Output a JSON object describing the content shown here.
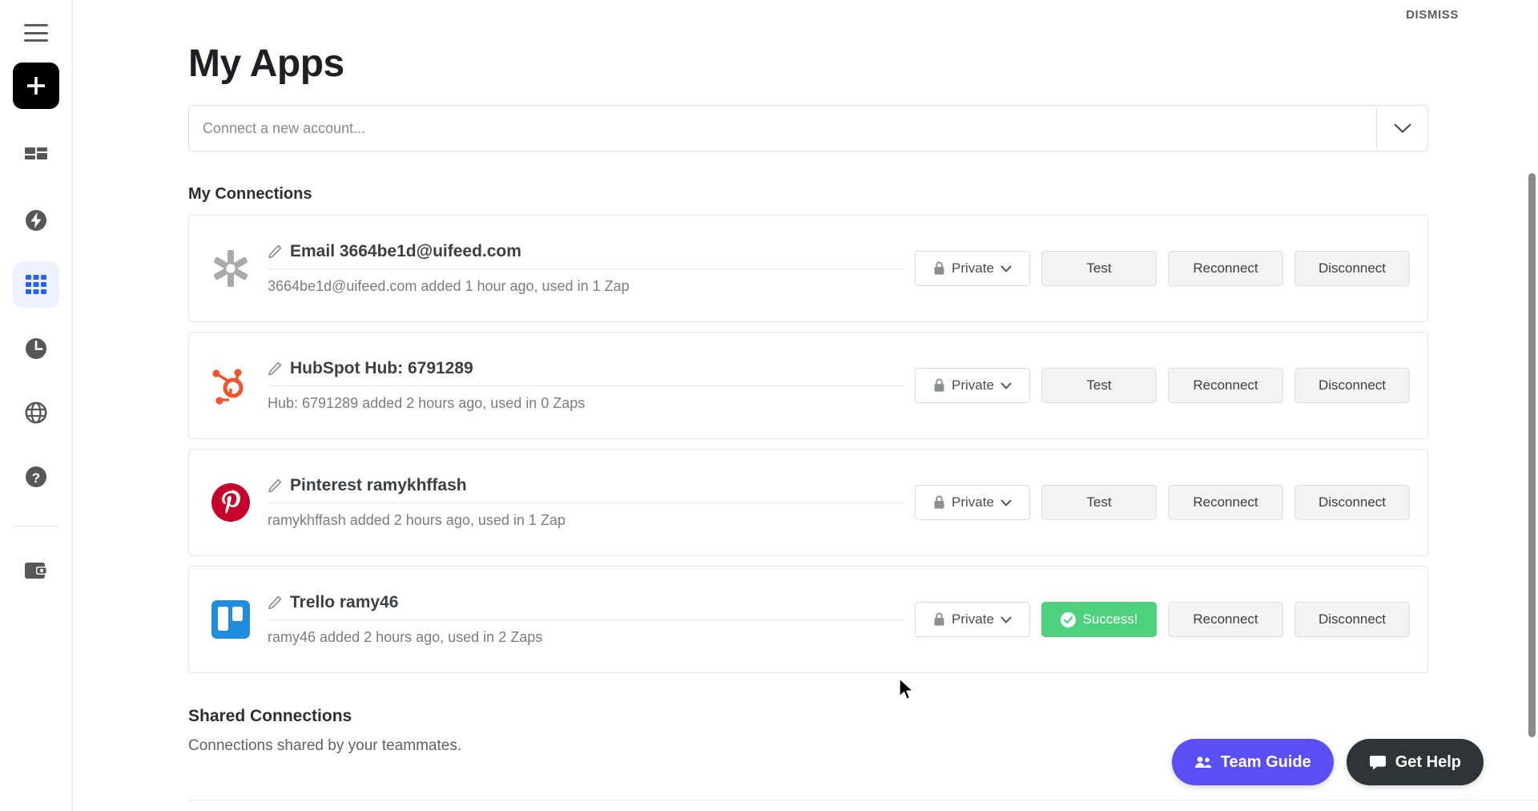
{
  "sidebar": {
    "menu_icon": "hamburger-menu-icon",
    "create_label": "+",
    "items": [
      {
        "icon": "dashboard-icon",
        "name": "dashboard",
        "active": false
      },
      {
        "icon": "zap-bolt-icon",
        "name": "zaps",
        "active": false
      },
      {
        "icon": "apps-grid-icon",
        "name": "apps",
        "active": true
      },
      {
        "icon": "history-clock-icon",
        "name": "history",
        "active": false
      },
      {
        "icon": "globe-icon",
        "name": "explore",
        "active": false
      },
      {
        "icon": "help-question-icon",
        "name": "help",
        "active": false
      },
      {
        "icon": "wallet-icon",
        "name": "billing",
        "active": false
      }
    ]
  },
  "header": {
    "dismiss_label": "DISMISS"
  },
  "page": {
    "title": "My Apps",
    "connect_placeholder": "Connect a new account...",
    "connect_caret_icon": "chevron-down-icon",
    "my_connections_heading": "My Connections",
    "shared_heading": "Shared Connections",
    "shared_subtext": "Connections shared by your teammates."
  },
  "connections": [
    {
      "icon": "email-asterisk-icon",
      "icon_color": "#a8abad",
      "title": "Email 3664be1d@uifeed.com",
      "subtitle": "3664be1d@uifeed.com added 1 hour ago, used in 1 Zap",
      "edit_icon": "pencil-icon",
      "visibility_label": "Private",
      "visibility_icon": "lock-icon",
      "visibility_caret": "chevron-down-icon",
      "test_label": "Test",
      "test_state": "default",
      "reconnect_label": "Reconnect",
      "disconnect_label": "Disconnect"
    },
    {
      "icon": "hubspot-icon",
      "icon_color": "#f2542d",
      "title": "HubSpot Hub: 6791289",
      "subtitle": "Hub: 6791289 added 2 hours ago, used in 0 Zaps",
      "edit_icon": "pencil-icon",
      "visibility_label": "Private",
      "visibility_icon": "lock-icon",
      "visibility_caret": "chevron-down-icon",
      "test_label": "Test",
      "test_state": "default",
      "reconnect_label": "Reconnect",
      "disconnect_label": "Disconnect"
    },
    {
      "icon": "pinterest-icon",
      "icon_color": "#c8012b",
      "title": "Pinterest ramykhffash",
      "subtitle": "ramykhffash added 2 hours ago, used in 1 Zap",
      "edit_icon": "pencil-icon",
      "visibility_label": "Private",
      "visibility_icon": "lock-icon",
      "visibility_caret": "chevron-down-icon",
      "test_label": "Test",
      "test_state": "default",
      "reconnect_label": "Reconnect",
      "disconnect_label": "Disconnect"
    },
    {
      "icon": "trello-icon",
      "icon_color": "#1e8ddd",
      "title": "Trello ramy46",
      "subtitle": "ramy46 added 2 hours ago, used in 2 Zaps",
      "edit_icon": "pencil-icon",
      "visibility_label": "Private",
      "visibility_icon": "lock-icon",
      "visibility_caret": "chevron-down-icon",
      "test_label": "Success!",
      "test_state": "success",
      "test_success_icon": "check-circle-icon",
      "reconnect_label": "Reconnect",
      "disconnect_label": "Disconnect"
    }
  ],
  "floating": {
    "team_guide_label": "Team Guide",
    "team_guide_icon": "people-icon",
    "get_help_label": "Get Help",
    "get_help_icon": "chat-bubble-icon"
  },
  "colors": {
    "accent_purple": "#5c4ef5",
    "dark": "#2f3437",
    "success_green": "#4ed17c",
    "active_nav_blue": "#2463eb",
    "active_nav_bg": "#eef2fe"
  }
}
